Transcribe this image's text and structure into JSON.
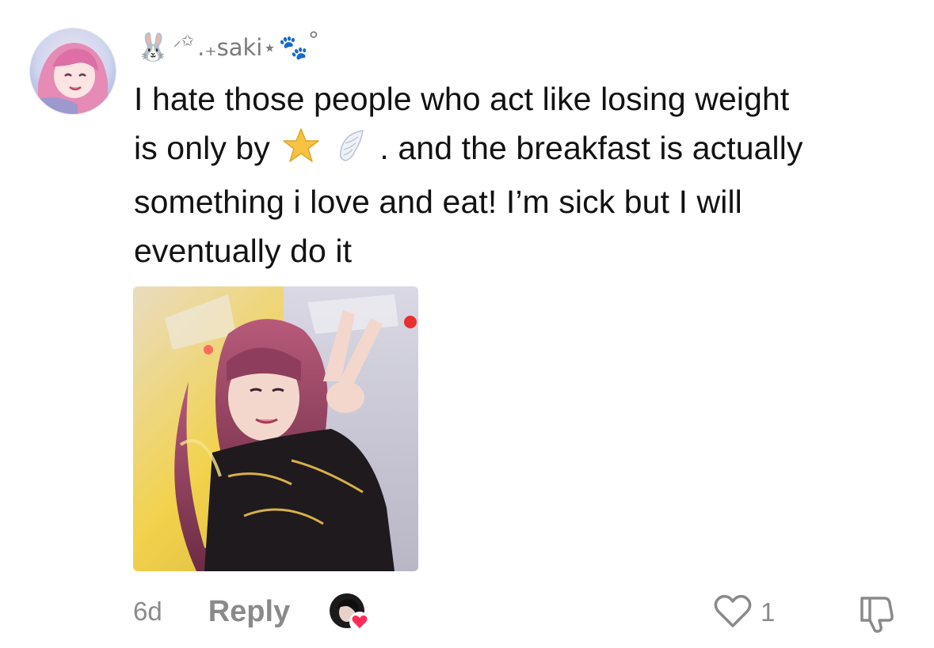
{
  "comment": {
    "username": ".₊saki⋆",
    "username_prefix_emoji": "🐰",
    "username_suffix": "°",
    "text_lines": [
      "I hate those people who act like losing weight",
      ". and the breakfast is actually",
      "something i love and eat! I’m sick but I will",
      "eventually do it"
    ],
    "line2_prefix": "is only by",
    "inline_emojis": [
      "star-icon",
      "wing-icon"
    ],
    "timestamp": "6d",
    "reply_label": "Reply",
    "like_count": "1"
  },
  "colors": {
    "text_primary": "#121212",
    "text_secondary": "#8a8a8a",
    "heart_badge": "#fe2c55",
    "star": "#f6c343"
  }
}
